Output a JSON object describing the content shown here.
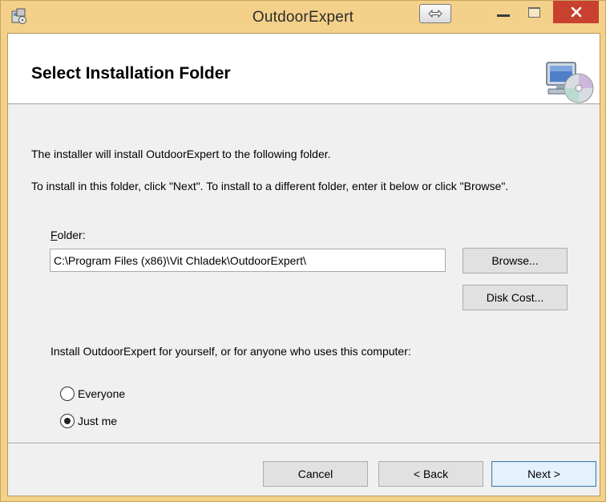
{
  "window": {
    "title": "OutdoorExpert",
    "close_color": "#c7412e",
    "frame_color": "#f4d18a"
  },
  "banner": {
    "title": "Select Installation Folder",
    "icon": "computer-cd-icon"
  },
  "description": {
    "line1": "The installer will install OutdoorExpert to the following folder.",
    "line2": "To install in this folder, click \"Next\". To install to a different folder, enter it below or click \"Browse\"."
  },
  "folder": {
    "label_access_key": "F",
    "label_rest": "older:",
    "value": "C:\\Program Files (x86)\\Vit Chladek\\OutdoorExpert\\"
  },
  "buttons": {
    "browse": "Browse...",
    "disk_cost": "Disk Cost...",
    "cancel": "Cancel",
    "back": "< Back",
    "next": "Next >"
  },
  "scope": {
    "label": "Install OutdoorExpert for yourself, or for anyone who uses this computer:",
    "options": [
      {
        "label": "Everyone",
        "selected": false
      },
      {
        "label": "Just me",
        "selected": true
      }
    ]
  }
}
